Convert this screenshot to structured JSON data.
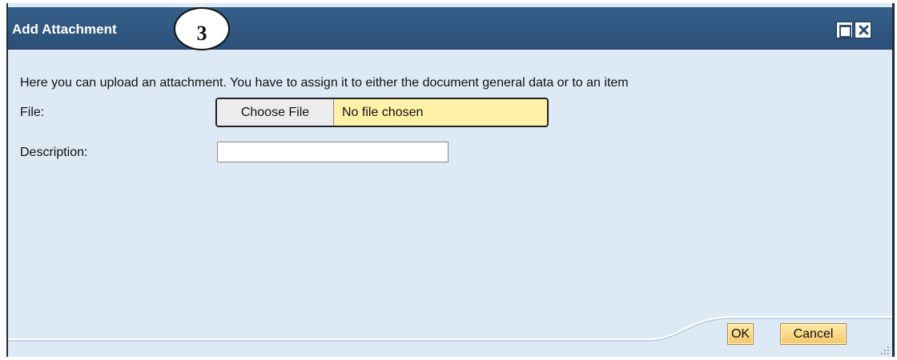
{
  "dialog": {
    "title": "Add Attachment",
    "step_marker": "3",
    "instruction": "Here you can upload an attachment. You have to assign it to either the document general data or to an item",
    "file_label": "File:",
    "choose_file_label": "Choose File",
    "file_status": "No file chosen",
    "description_label": "Description:",
    "description_value": "",
    "ok_label": "OK",
    "cancel_label": "Cancel"
  },
  "icons": {
    "maximize": "maximize-icon",
    "close": "close-icon",
    "resize": "resize-grip-icon"
  },
  "colors": {
    "titlebar": "#2f5781",
    "dialog_bg": "#dde9f5",
    "file_highlight": "#fff1a8",
    "button": "#f6c86a"
  }
}
